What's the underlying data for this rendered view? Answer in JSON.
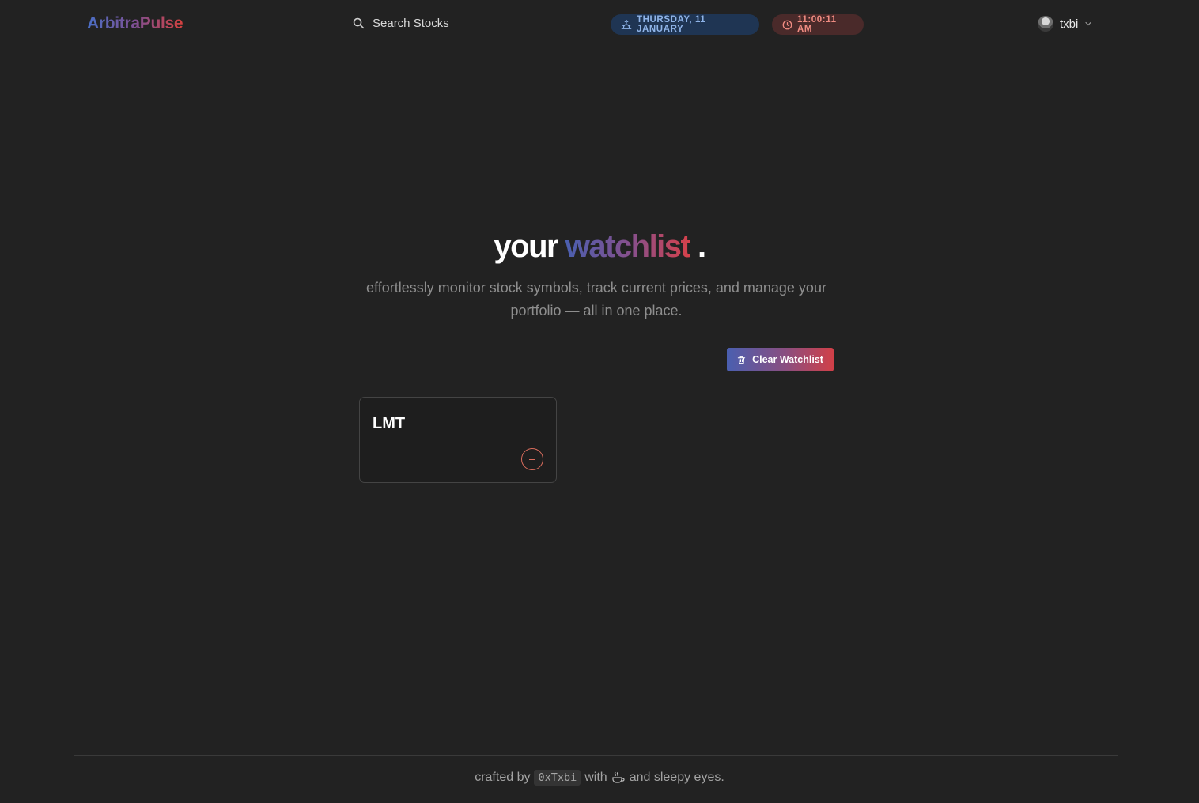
{
  "header": {
    "logo": "ArbitraPulse",
    "search_label": "Search Stocks",
    "date": "THURSDAY, 11 JANUARY",
    "time": "11:00:11 AM",
    "user_name": "txbi"
  },
  "hero": {
    "title_word1": "your",
    "title_word2": "watchlist",
    "title_dot": ".",
    "subtitle": "effortlessly monitor stock symbols, track current prices, and manage your portfolio — all in one place.",
    "clear_button_label": "Clear Watchlist"
  },
  "watchlist": [
    {
      "symbol": "LMT"
    }
  ],
  "footer": {
    "prefix": "crafted by",
    "handle": "0xTxbi",
    "with": "with",
    "suffix": "and sleepy eyes."
  },
  "colors": {
    "background": "#222222",
    "brand_blue": "#4a5fb0",
    "brand_red": "#d6414a",
    "date_pill_bg": "#1f3553",
    "time_pill_bg": "#4a2a2a"
  },
  "icons": {
    "search": "search-icon",
    "date": "sunrise-icon",
    "time": "clock-icon",
    "user_menu": "chevron-down-icon",
    "clear": "trash-icon",
    "remove": "minus-circle-icon",
    "footer": "coffee-icon"
  }
}
